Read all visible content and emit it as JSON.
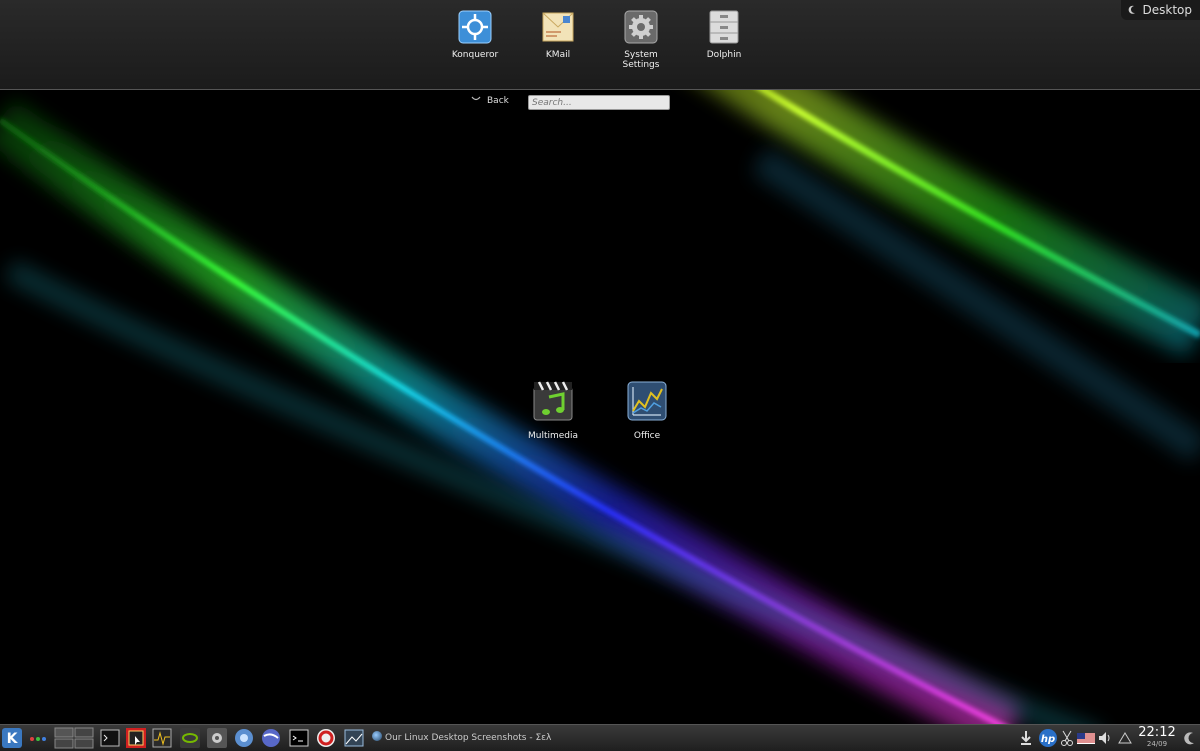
{
  "favorites": [
    {
      "label": "Konqueror",
      "icon": "konqueror-icon"
    },
    {
      "label": "KMail",
      "icon": "kmail-icon"
    },
    {
      "label": "System\nSettings",
      "icon": "system-settings-icon"
    },
    {
      "label": "Dolphin",
      "icon": "dolphin-icon"
    }
  ],
  "activity": {
    "label": "Desktop",
    "icon": "cashew-icon"
  },
  "navigation": {
    "back_label": "Back",
    "search_placeholder": "Search...",
    "search_value": ""
  },
  "categories": [
    {
      "label": "Multimedia",
      "icon": "multimedia-icon"
    },
    {
      "label": "Office",
      "icon": "office-icon"
    }
  ],
  "taskbar": {
    "launchers": [
      "kde-menu-icon",
      "activity-dots-icon",
      "pager-icon",
      "terminal-icon",
      "screenshot-icon",
      "system-monitor-icon",
      "nvidia-icon",
      "settings-icon",
      "chromium-icon",
      "konqueror-globe-icon",
      "konsole-icon",
      "opera-icon",
      "image-viewer-icon"
    ],
    "task_title": "Our Linux Desktop Screenshots - Σελί",
    "tray": [
      "download-icon",
      "hp-icon",
      "scissors-icon",
      "us-flag-icon",
      "volume-icon",
      "notifications-icon"
    ],
    "clock_time": "22:12",
    "clock_date": "24/09"
  },
  "colors": {
    "panel": "#2a2a2a",
    "accent_green": "#7fff00",
    "accent_cyan": "#00e5ff",
    "accent_magenta": "#ff40ff"
  }
}
